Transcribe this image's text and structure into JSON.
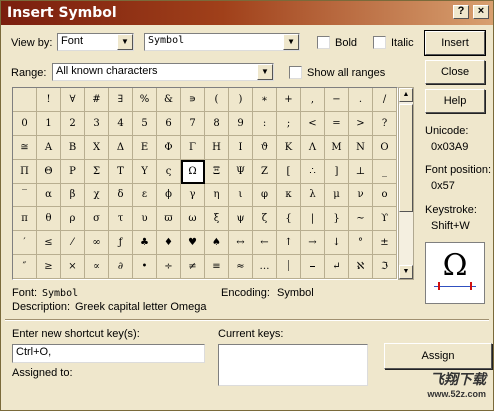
{
  "window": {
    "title": "Insert Symbol"
  },
  "controls": {
    "view_by_label": "View by:",
    "view_by_value": "Font",
    "font_value": "Symbol",
    "bold_label": "Bold",
    "italic_label": "Italic",
    "range_label": "Range:",
    "range_value": "All known characters",
    "show_all_ranges_label": "Show all ranges"
  },
  "buttons": {
    "insert": "Insert",
    "close": "Close",
    "help": "Help",
    "assign": "Assign"
  },
  "info": {
    "unicode_label": "Unicode:",
    "unicode_value": "0x03A9",
    "font_position_label": "Font position:",
    "font_position_value": "0x57",
    "keystroke_label": "Keystroke:",
    "keystroke_value": "Shift+W",
    "preview_glyph": "Ω"
  },
  "details": {
    "font_label": "Font:",
    "font_value": "Symbol",
    "encoding_label": "Encoding:",
    "encoding_value": "Symbol",
    "description_label": "Description:",
    "description_value": "Greek capital letter Omega"
  },
  "shortcut": {
    "new_key_label": "Enter new shortcut key(s):",
    "new_key_value": "Ctrl+O,",
    "current_keys_label": "Current keys:",
    "assigned_to_label": "Assigned to:"
  },
  "grid": {
    "selected_row": 3,
    "selected_col": 7,
    "rows": [
      [
        "",
        "!",
        "∀",
        "#",
        "∃",
        "%",
        "&",
        "∍",
        "(",
        ")",
        "∗",
        "+",
        ",",
        "−",
        ".",
        "/"
      ],
      [
        "0",
        "1",
        "2",
        "3",
        "4",
        "5",
        "6",
        "7",
        "8",
        "9",
        ":",
        ";",
        "<",
        "=",
        ">",
        "?"
      ],
      [
        "≅",
        "Α",
        "Β",
        "Χ",
        "Δ",
        "Ε",
        "Φ",
        "Γ",
        "Η",
        "Ι",
        "ϑ",
        "Κ",
        "Λ",
        "Μ",
        "Ν",
        "Ο"
      ],
      [
        "Π",
        "Θ",
        "Ρ",
        "Σ",
        "Τ",
        "Υ",
        "ς",
        "Ω",
        "Ξ",
        "Ψ",
        "Ζ",
        "[",
        "∴",
        "]",
        "⊥",
        "_"
      ],
      [
        "‾",
        "α",
        "β",
        "χ",
        "δ",
        "ε",
        "ϕ",
        "γ",
        "η",
        "ι",
        "φ",
        "κ",
        "λ",
        "μ",
        "ν",
        "ο"
      ],
      [
        "π",
        "θ",
        "ρ",
        "σ",
        "τ",
        "υ",
        "ϖ",
        "ω",
        "ξ",
        "ψ",
        "ζ",
        "{",
        "|",
        "}",
        "∼",
        "ϒ"
      ],
      [
        "′",
        "≤",
        "⁄",
        "∞",
        "ƒ",
        "♣",
        "♦",
        "♥",
        "♠",
        "↔",
        "←",
        "↑",
        "→",
        "↓",
        "°",
        "±"
      ],
      [
        "″",
        "≥",
        "×",
        "∝",
        "∂",
        "•",
        "÷",
        "≠",
        "≡",
        "≈",
        "…",
        "⏐",
        "⎯",
        "↵",
        "ℵ",
        "ℑ"
      ]
    ]
  },
  "watermark": {
    "line1": "飞翔下载",
    "line2": "www.52z.com"
  }
}
